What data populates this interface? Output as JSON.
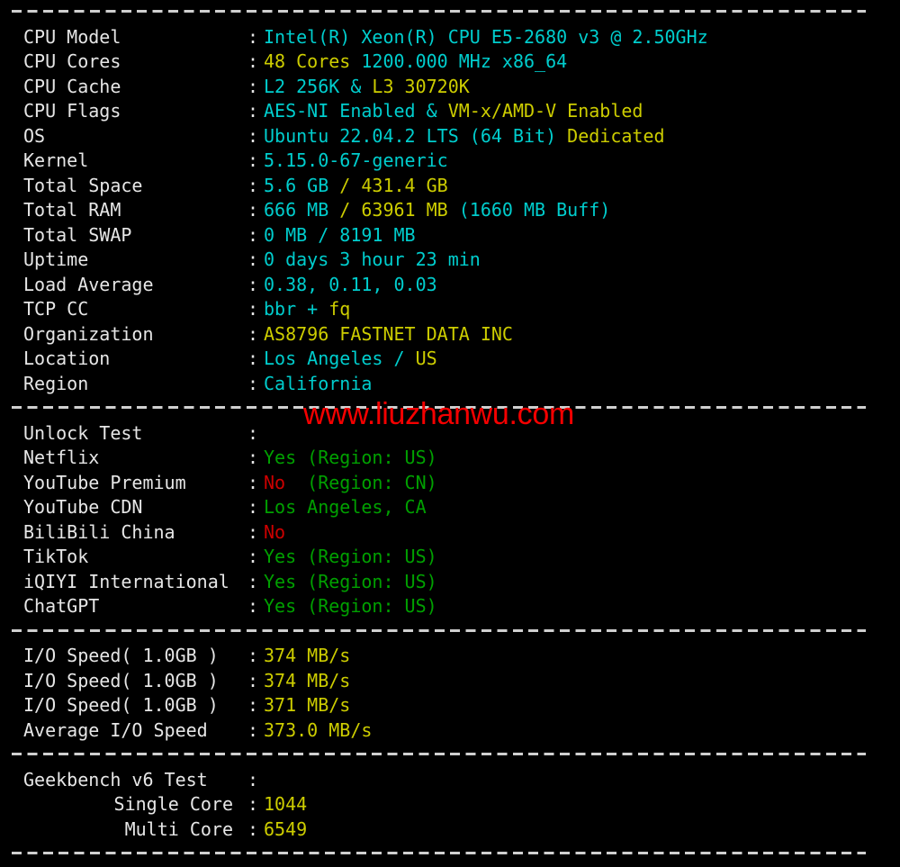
{
  "theme": {
    "background": "#000000",
    "label_color": "#e6e6e6",
    "cyan": "#00cdcd",
    "yellow": "#cdcd00",
    "green": "#00a000",
    "red": "#cd0000",
    "watermark_color": "#f40000",
    "separator_color": "#cfcfcf"
  },
  "watermark": {
    "text": "www.liuzhanwu.com"
  },
  "colon": ":",
  "sections": {
    "system": {
      "rows": [
        {
          "label": "CPU Model",
          "parts": [
            {
              "text": "Intel(R) Xeon(R) CPU E5-2680 v3 @ 2.50GHz",
              "color": "cyan"
            }
          ]
        },
        {
          "label": "CPU Cores",
          "parts": [
            {
              "text": "48 Cores ",
              "color": "yellow"
            },
            {
              "text": "1200.000 MHz x86_64",
              "color": "cyan"
            }
          ]
        },
        {
          "label": "CPU Cache",
          "parts": [
            {
              "text": "L2 256K & ",
              "color": "cyan"
            },
            {
              "text": "L3 30720K",
              "color": "yellow"
            }
          ]
        },
        {
          "label": "CPU Flags",
          "parts": [
            {
              "text": "AES-NI Enabled & ",
              "color": "cyan"
            },
            {
              "text": "VM-x/AMD-V Enabled",
              "color": "yellow"
            }
          ]
        },
        {
          "label": "OS",
          "parts": [
            {
              "text": "Ubuntu 22.04.2 LTS (64 Bit) ",
              "color": "cyan"
            },
            {
              "text": "Dedicated",
              "color": "yellow"
            }
          ]
        },
        {
          "label": "Kernel",
          "parts": [
            {
              "text": "5.15.0-67-generic",
              "color": "cyan"
            }
          ]
        },
        {
          "label": "Total Space",
          "parts": [
            {
              "text": "5.6 GB ",
              "color": "cyan"
            },
            {
              "text": "/ 431.4 GB",
              "color": "yellow"
            }
          ]
        },
        {
          "label": "Total RAM",
          "parts": [
            {
              "text": "666 MB ",
              "color": "cyan"
            },
            {
              "text": "/ 63961 MB ",
              "color": "yellow"
            },
            {
              "text": "(1660 MB Buff)",
              "color": "cyan"
            }
          ]
        },
        {
          "label": "Total SWAP",
          "parts": [
            {
              "text": "0 MB / 8191 MB",
              "color": "cyan"
            }
          ]
        },
        {
          "label": "Uptime",
          "parts": [
            {
              "text": "0 days 3 hour 23 min",
              "color": "cyan"
            }
          ]
        },
        {
          "label": "Load Average",
          "parts": [
            {
              "text": "0.38, 0.11, 0.03",
              "color": "cyan"
            }
          ]
        },
        {
          "label": "TCP CC",
          "parts": [
            {
              "text": "bbr + ",
              "color": "cyan"
            },
            {
              "text": "fq",
              "color": "yellow"
            }
          ]
        },
        {
          "label": "Organization",
          "parts": [
            {
              "text": "AS8796 FASTNET DATA INC",
              "color": "yellow"
            }
          ]
        },
        {
          "label": "Location",
          "parts": [
            {
              "text": "Los Angeles / ",
              "color": "cyan"
            },
            {
              "text": "US",
              "color": "yellow"
            }
          ]
        },
        {
          "label": "Region",
          "parts": [
            {
              "text": "California",
              "color": "cyan"
            }
          ]
        }
      ]
    },
    "unlock": {
      "rows": [
        {
          "label": "Unlock Test",
          "parts": []
        },
        {
          "label": "Netflix",
          "parts": [
            {
              "text": "Yes (Region: US)",
              "color": "green"
            }
          ]
        },
        {
          "label": "YouTube Premium",
          "parts": [
            {
              "text": "No ",
              "color": "red"
            },
            {
              "text": " (Region: CN)",
              "color": "green"
            }
          ]
        },
        {
          "label": "YouTube CDN",
          "parts": [
            {
              "text": "Los Angeles, CA",
              "color": "green"
            }
          ]
        },
        {
          "label": "BiliBili China",
          "parts": [
            {
              "text": "No",
              "color": "red"
            }
          ]
        },
        {
          "label": "TikTok",
          "parts": [
            {
              "text": "Yes (Region: US)",
              "color": "green"
            }
          ]
        },
        {
          "label": "iQIYI International",
          "parts": [
            {
              "text": "Yes (Region: US)",
              "color": "green"
            }
          ]
        },
        {
          "label": "ChatGPT",
          "parts": [
            {
              "text": "Yes (Region: US)",
              "color": "green"
            }
          ]
        }
      ]
    },
    "io": {
      "rows": [
        {
          "label": "I/O Speed( 1.0GB )",
          "parts": [
            {
              "text": "374 MB/s",
              "color": "yellow"
            }
          ]
        },
        {
          "label": "I/O Speed( 1.0GB )",
          "parts": [
            {
              "text": "374 MB/s",
              "color": "yellow"
            }
          ]
        },
        {
          "label": "I/O Speed( 1.0GB )",
          "parts": [
            {
              "text": "371 MB/s",
              "color": "yellow"
            }
          ]
        },
        {
          "label": "Average I/O Speed",
          "parts": [
            {
              "text": "373.0 MB/s",
              "color": "yellow"
            }
          ]
        }
      ]
    },
    "geekbench": {
      "rows": [
        {
          "label": "Geekbench v6 Test",
          "parts": []
        },
        {
          "label": "Single Core",
          "align": "right",
          "parts": [
            {
              "text": "1044",
              "color": "yellow"
            }
          ]
        },
        {
          "label": "Multi Core",
          "align": "right",
          "parts": [
            {
              "text": "6549",
              "color": "yellow"
            }
          ]
        }
      ]
    }
  }
}
